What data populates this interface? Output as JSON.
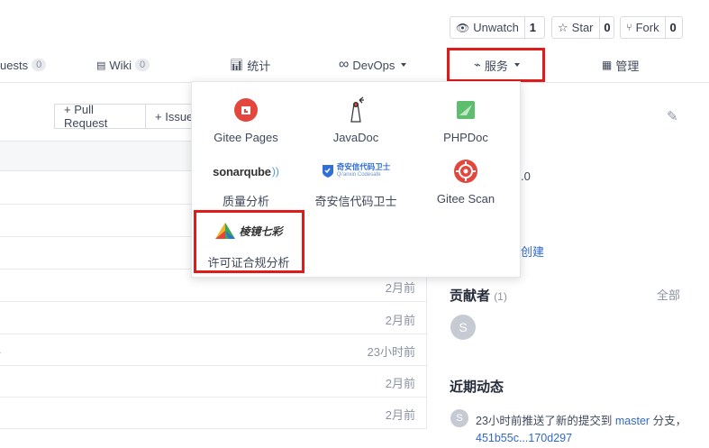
{
  "actions": {
    "watch_label": "Unwatch",
    "watch_count": "1",
    "star_label": "Star",
    "star_count": "0",
    "fork_label": "Fork",
    "fork_count": "0"
  },
  "nav": {
    "pull_requests_label": "uests",
    "pull_requests_count": "0",
    "wiki_label": "Wiki",
    "wiki_count": "0",
    "stats_label": "统计",
    "devops_label": "DevOps",
    "services_label": "服务",
    "manage_label": "管理"
  },
  "toolbar": {
    "pull_request_label": "+ Pull Request",
    "issue_label": "+ Issue"
  },
  "services": [
    {
      "name": "Gitee Pages",
      "icon": "gitee-pages-icon"
    },
    {
      "name": "JavaDoc",
      "icon": "javadoc-icon"
    },
    {
      "name": "PHPDoc",
      "icon": "phpdoc-icon"
    },
    {
      "name": "质量分析",
      "icon": "sonarqube-icon",
      "logo_text": "sonarqube"
    },
    {
      "name": "奇安信代码卫士",
      "icon": "qianxin-codesafe-icon",
      "logo_text": "奇安信代码卫士",
      "logo_subtext": "Qi'anxin Codesafe"
    },
    {
      "name": "Gitee Scan",
      "icon": "gitee-scan-icon"
    },
    {
      "name": "许可证合规分析",
      "icon": "license-compliance-icon",
      "logo_text": "棱镜七彩"
    }
  ],
  "file_rows": [
    {
      "time": "",
      "left": ""
    },
    {
      "time": "",
      "left": ""
    },
    {
      "time": "",
      "left": ""
    },
    {
      "time": "2月前",
      "left": ""
    },
    {
      "time": "2月前",
      "left": ""
    },
    {
      "time": "23小时前",
      "left": "."
    },
    {
      "time": "2月前",
      "left": ""
    },
    {
      "time": "2月前",
      "left": ""
    }
  ],
  "sidebar": {
    "version_fragment": ".0",
    "create_fragment": "创建",
    "contributors_title": "贡献者",
    "contributors_count": "(1)",
    "contributors_all": "全部",
    "contributor_initial": "S",
    "activity_title": "近期动态",
    "activity_initial": "S",
    "activity_text_prefix": "23小时前推送了新的提交到",
    "activity_branch": "master",
    "activity_text_mid": "分支，",
    "activity_commits": "451b55c...170d297"
  },
  "colors": {
    "highlight_red": "#e11a1a",
    "link_blue": "#3169c6",
    "gitee_red": "#e3463c",
    "phpdoc_green": "#5fbd6e"
  }
}
